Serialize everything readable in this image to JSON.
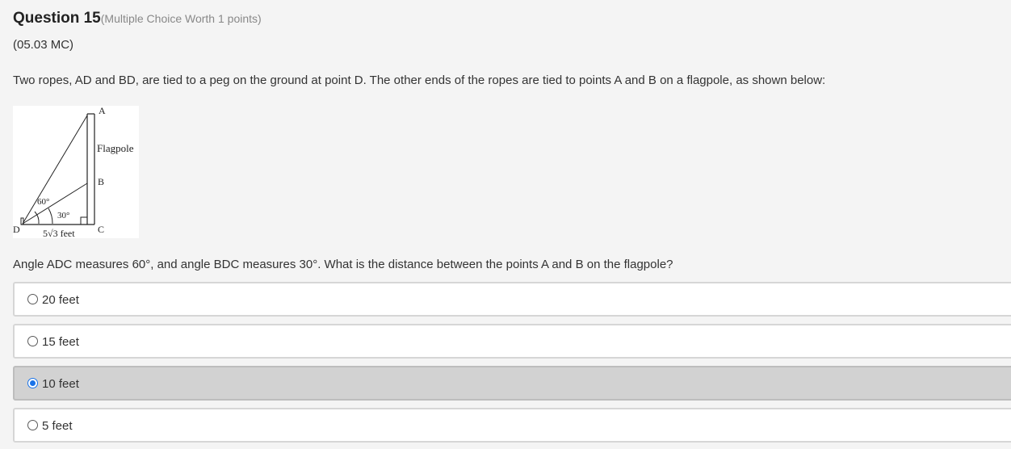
{
  "question": {
    "title": "Question 15",
    "worth": "(Multiple Choice Worth 1 points)",
    "code": "(05.03 MC)",
    "stem": "Two ropes, AD and BD, are tied to a peg on the ground at point D. The other ends of the ropes are tied to points A and B on a flagpole, as shown below:",
    "prompt": "Angle ADC measures 60°, and angle BDC measures 30°. What is the distance between the points A and B on the flagpole?"
  },
  "figure": {
    "label_a": "A",
    "label_b": "B",
    "label_c": "C",
    "label_d": "D",
    "label_flagpole": "Flagpole",
    "angle_adc": "60°",
    "angle_bdc": "30°",
    "base_length": "5√3 feet"
  },
  "choices": [
    {
      "label": "20 feet",
      "selected": false
    },
    {
      "label": "15 feet",
      "selected": false
    },
    {
      "label": "10 feet",
      "selected": true
    },
    {
      "label": "5 feet",
      "selected": false
    }
  ],
  "colors": {
    "background": "#f4f4f4",
    "selected_background": "#d2d2d2",
    "radio_accent": "#1a73e8"
  }
}
